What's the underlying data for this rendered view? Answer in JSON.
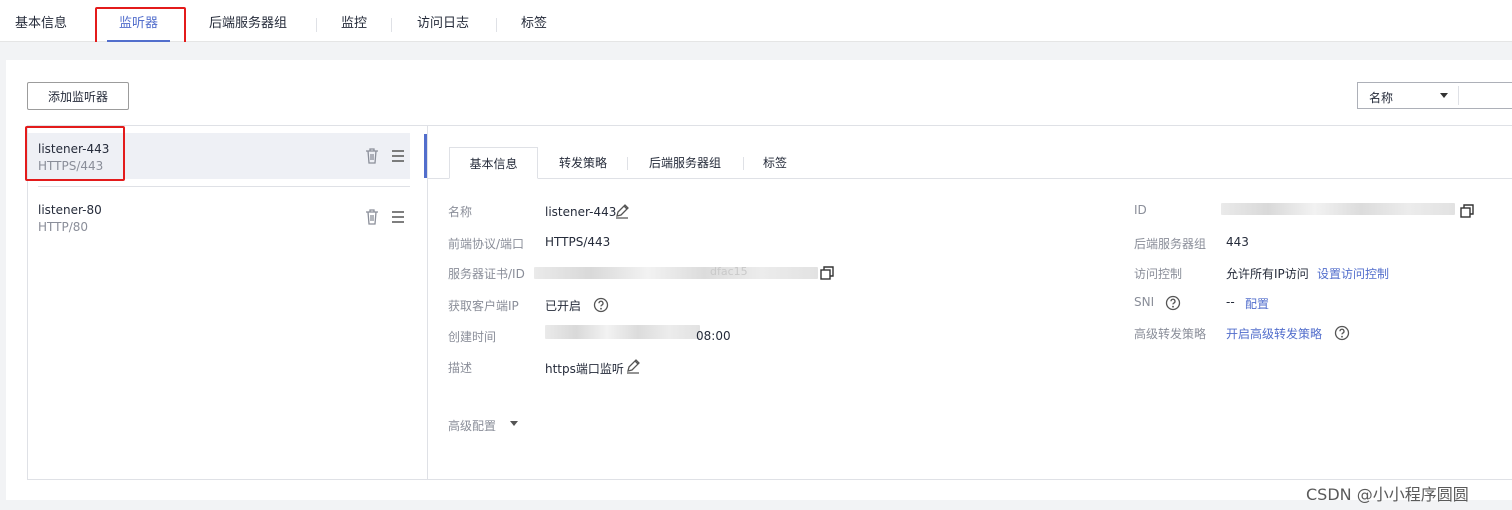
{
  "top_tabs": [
    "基本信息",
    "监听器",
    "后端服务器组",
    "监控",
    "访问日志",
    "标签"
  ],
  "toolbar": {
    "add_label": "添加监听器",
    "filter_select_value": "名称"
  },
  "listeners": [
    {
      "name": "listener-443",
      "protocol": "HTTPS/443"
    },
    {
      "name": "listener-80",
      "protocol": "HTTP/80"
    }
  ],
  "inner_tabs": [
    "基本信息",
    "转发策略",
    "后端服务器组",
    "标签"
  ],
  "detail": {
    "name_label": "名称",
    "name_value": "listener-443",
    "frontend_label": "前端协议/端口",
    "frontend_value": "HTTPS/443",
    "cert_label": "服务器证书/ID",
    "cert_value_tail": "dfac15",
    "client_ip_label": "获取客户端IP",
    "client_ip_value": "已开启",
    "created_label": "创建时间",
    "created_value_tail": "08:00",
    "desc_label": "描述",
    "desc_value": "https端口监听",
    "advanced_label": "高级配置",
    "id_label": "ID",
    "backend_group_label": "后端服务器组",
    "backend_group_value": "443",
    "access_label": "访问控制",
    "access_value": "允许所有IP访问",
    "access_link": "设置访问控制",
    "sni_label": "SNI",
    "sni_value": "--",
    "sni_link": "配置",
    "forward_label": "高级转发策略",
    "forward_link": "开启高级转发策略"
  },
  "watermark": "CSDN @小小程序圆圆",
  "colors": {
    "accent": "#526ecc",
    "highlight": "#e31b1b",
    "background": "#f2f3f5"
  }
}
